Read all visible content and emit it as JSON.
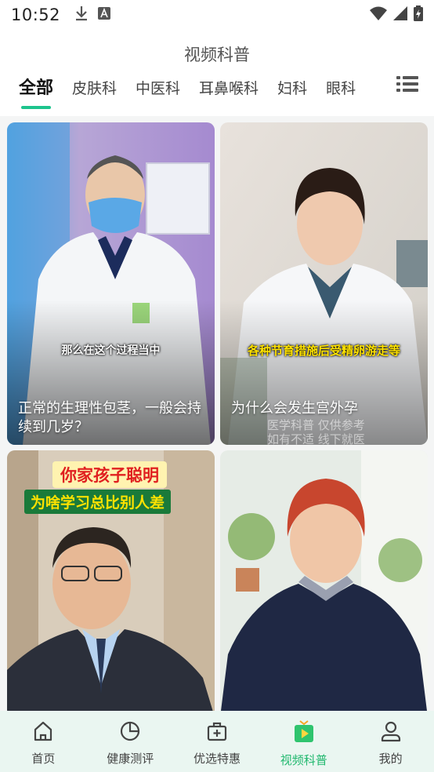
{
  "status": {
    "time": "10:52"
  },
  "header": {
    "title": "视频科普",
    "tabs": [
      "全部",
      "皮肤科",
      "中医科",
      "耳鼻喉科",
      "妇科",
      "眼科"
    ],
    "active_tab": 0
  },
  "cards": [
    {
      "caption": "那么在这个过程当中",
      "title": "正常的生理性包茎，一般会持续到几岁？"
    },
    {
      "caption": "各种节育措施后受精卵游走等",
      "title": "为什么会发生宫外孕",
      "watermark": "医学科普 仅供参考\n如有不适 线下就医"
    },
    {
      "banner1": "你家孩子聪明",
      "banner2": "为啥学习总比别人差"
    },
    {}
  ],
  "tabbar": {
    "items": [
      "首页",
      "健康测评",
      "优选特惠",
      "视频科普",
      "我的"
    ],
    "active": 3
  },
  "colors": {
    "accent": "#1dc48d",
    "tab_active": "#22b86f"
  }
}
